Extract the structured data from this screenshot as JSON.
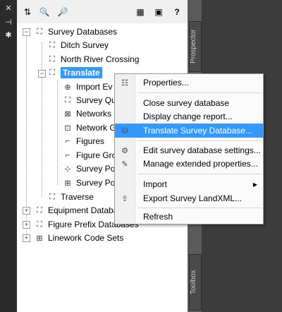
{
  "side_tabs": {
    "prospector": "Prospector",
    "toolbox": "Toolbox"
  },
  "tree": {
    "root": "Survey Databases",
    "databases": [
      "Ditch Survey",
      "North River Crossing",
      "Translate"
    ],
    "translate_children": [
      "Import Ev",
      "Survey Qu",
      "Networks",
      "Network G",
      "Figures",
      "Figure Gro",
      "Survey Po",
      "Survey Po"
    ],
    "after": [
      "Traverse"
    ],
    "other_roots": [
      "Equipment Databa",
      "Figure Prefix Databases",
      "Linework Code Sets"
    ]
  },
  "context_menu": {
    "items": [
      {
        "label": "Properties...",
        "icon": "properties-icon"
      },
      {
        "label": "Close survey database",
        "icon": ""
      },
      {
        "label": "Display change report...",
        "icon": ""
      },
      {
        "label": "Translate Survey Database...",
        "icon": "database-icon",
        "highlighted": true
      },
      {
        "label": "Edit survey database settings...",
        "icon": "settings-icon"
      },
      {
        "label": "Manage extended properties...",
        "icon": "extended-properties-icon"
      },
      {
        "label": "Import",
        "icon": "",
        "submenu": true
      },
      {
        "label": "Export Survey LandXML...",
        "icon": "export-icon"
      },
      {
        "label": "Refresh",
        "icon": ""
      }
    ]
  },
  "colors": {
    "selection": "#3399ff",
    "dark_bg": "#3c3c3c"
  }
}
